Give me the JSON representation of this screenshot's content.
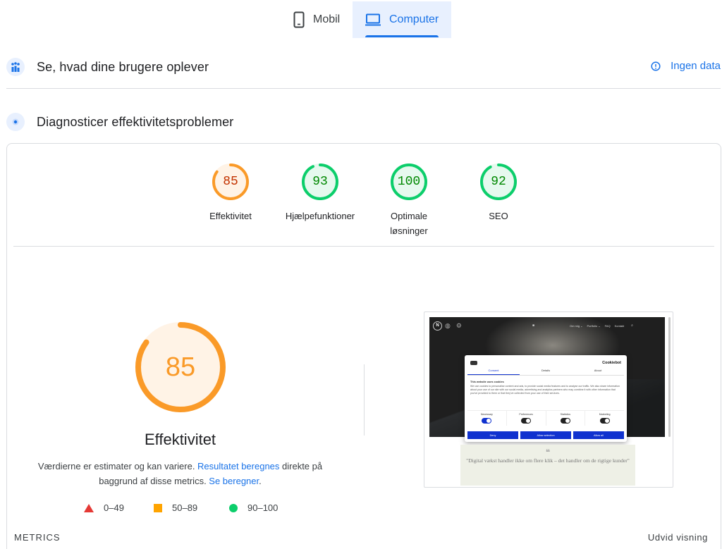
{
  "tabs": [
    {
      "label": "Mobil",
      "icon": "phone-icon",
      "active": false
    },
    {
      "label": "Computer",
      "icon": "laptop-icon",
      "active": true
    }
  ],
  "field_data": {
    "title": "Se, hvad dine brugere oplever",
    "status_label": "Ingen data",
    "icon": "users-chart-icon"
  },
  "diagnose": {
    "title": "Diagnosticer effektivitetsproblemer",
    "icon": "lighthouse-icon"
  },
  "scores": [
    {
      "label": "Effektivitet",
      "value": "85",
      "score": 85,
      "status": "average"
    },
    {
      "label": "Hjælpefunktioner",
      "value": "93",
      "score": 93,
      "status": "pass"
    },
    {
      "label": "Optimale løsninger",
      "value": "100",
      "score": 100,
      "status": "pass"
    },
    {
      "label": "SEO",
      "value": "92",
      "score": 92,
      "status": "pass"
    }
  ],
  "performance": {
    "score": "85",
    "score_value": 85,
    "title": "Effektivitet",
    "description_prefix": "Værdierne er estimater og kan variere. ",
    "link1": "Resultatet beregnes",
    "description_middle": " direkte på baggrund af disse metrics. ",
    "link2": "Se beregner",
    "description_suffix": "."
  },
  "legend": [
    {
      "range": "0–49",
      "shape": "triangle",
      "color": "#e53935"
    },
    {
      "range": "50–89",
      "shape": "square",
      "color": "#ffa400"
    },
    {
      "range": "90–100",
      "shape": "circle",
      "color": "#0cce6b"
    }
  ],
  "metrics_label": "METRICS",
  "expand_label": "Udvid visning",
  "colors": {
    "accent": "#1a73e8",
    "average": "#fa9a28",
    "pass": "#0cce6b",
    "pass_text": "#008800",
    "average_text": "#c33300"
  },
  "thumbnail": {
    "nav_logo": "N",
    "nav_items": [
      "Om mig ⌄",
      "Portfolio ⌄",
      "FAQ",
      "Kontakt"
    ],
    "cookie": {
      "brand": "Cookiebot",
      "tabs": [
        "Consent",
        "Details",
        "About"
      ],
      "title": "This website uses cookies",
      "body": "We use cookies to personalise content and ads, to provide social media features and to analyse our traffic. We also share information about your use of our site with our social media, advertising and analytics partners who may combine it with other information that you've provided to them or that they've collected from your use of their services.",
      "toggles": [
        {
          "label": "Necessary",
          "on": true
        },
        {
          "label": "Preferences",
          "on": false
        },
        {
          "label": "Statistics",
          "on": false
        },
        {
          "label": "Marketing",
          "on": false
        }
      ],
      "buttons": [
        "Deny",
        "Allow selection",
        "Allow all"
      ]
    },
    "quote": "\"Digital vækst handler ikke om flere klik – det handler om de rigtige kunder\""
  }
}
